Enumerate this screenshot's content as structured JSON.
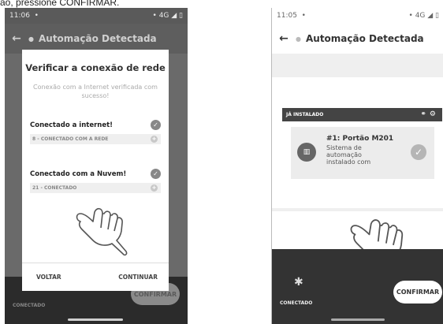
{
  "caption": "ão, pressione CONFIRMAR.",
  "screen1": {
    "status": {
      "time": "11:06",
      "dot": "•",
      "network": "• 4G ◢ ▯"
    },
    "appbar": {
      "back": "←",
      "title": "Automação Detectada"
    },
    "dialog": {
      "title": "Verificar a conexão de rede",
      "subtitle": "Conexão com a Internet verificada com sucesso!",
      "internet_label": "Conectado a internet!",
      "internet_value": "8 - CONECTADO COM A  REDE",
      "cloud_label": "Conectado com a Nuvem!",
      "cloud_value": "21 - CONECTADO",
      "back_button": "VOLTAR",
      "continue_button": "CONTINUAR"
    },
    "bottom": {
      "status_label": "CONECTADO",
      "confirm_button": "CONFIRMAR"
    }
  },
  "screen2": {
    "status": {
      "time": "11:05",
      "dot": "•",
      "network": "• 4G ◢ ▯"
    },
    "appbar": {
      "back": "←",
      "title": "Automação Detectada"
    },
    "section_title": "JÁ INSTALADO",
    "device": {
      "title": "#1: Portão M201",
      "description": "Sistema de automação instalado com"
    },
    "bottom": {
      "status_label": "CONECTADO",
      "confirm_button": "CONFIRMAR"
    }
  },
  "icons": [
    "back-arrow-icon",
    "check-icon",
    "plus-icon",
    "link-icon",
    "gear-icon",
    "device-icon",
    "bluetooth-icon",
    "hand-pointer-icon"
  ]
}
